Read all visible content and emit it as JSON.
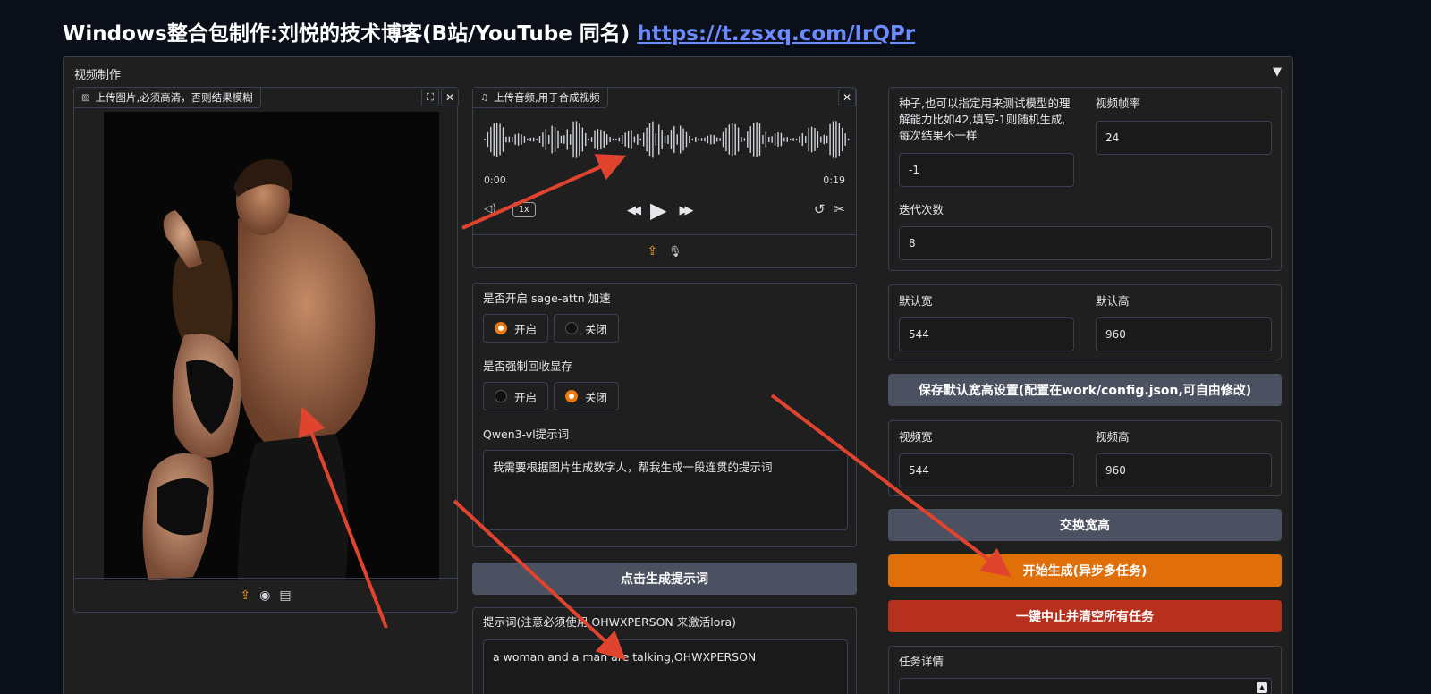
{
  "header": {
    "title": "Windows整合包制作:刘悦的技术博客(B站/YouTube 同名)",
    "link": "https://t.zsxq.com/IrQPr"
  },
  "accordion": {
    "label": "视频制作",
    "caret": "▼"
  },
  "image_input": {
    "label": "上传图片,必须高清，否则结果模糊",
    "fullscreen_icon": "⛶",
    "close_icon": "✕",
    "upload_icon": "⇪",
    "webcam_icon": "◉",
    "clipboard_icon": "▤"
  },
  "audio_input": {
    "label": "上传音频,用于合成视频",
    "current_time": "0:00",
    "duration": "0:19",
    "speed": "1x",
    "close_icon": "✕",
    "volume_icon": "◁)",
    "rewind_icon": "◀◀",
    "play_icon": "▶",
    "forward_icon": "▶▶",
    "undo_icon": "↺",
    "trim_icon": "✂",
    "upload_icon": "⇪",
    "mic_icon": "🎙"
  },
  "sage_attn": {
    "label": "是否开启 sage-attn 加速",
    "options": [
      "开启",
      "关闭"
    ],
    "selected": "开启"
  },
  "force_gc": {
    "label": "是否强制回收显存",
    "options": [
      "开启",
      "关闭"
    ],
    "selected": "关闭"
  },
  "qwen_prompt": {
    "label": "Qwen3-vl提示词",
    "value": "我需要根据图片生成数字人，帮我生成一段连贯的提示词"
  },
  "gen_prompt_button": "点击生成提示词",
  "prompt": {
    "label": "提示词(注意必须使用 OHWXPERSON 来激活lora)",
    "value": "a woman and a man are talking,OHWXPERSON"
  },
  "seed": {
    "label": "种子,也可以指定用来测试模型的理解能力比如42,填写-1则随机生成,每次结果不一样",
    "value": "-1"
  },
  "fps": {
    "label": "视频帧率",
    "value": "24"
  },
  "steps": {
    "label": "迭代次数",
    "value": "8"
  },
  "default_width": {
    "label": "默认宽",
    "value": "544"
  },
  "default_height": {
    "label": "默认高",
    "value": "960"
  },
  "save_default_button": "保存默认宽高设置(配置在work/config.json,可自由修改)",
  "video_width": {
    "label": "视频宽",
    "value": "544"
  },
  "video_height": {
    "label": "视频高",
    "value": "960"
  },
  "swap_button": "交换宽高",
  "start_button": "开始生成(异步多任务)",
  "stop_button": "一键中止并清空所有任务",
  "task_details": {
    "label": "任务详情"
  },
  "colors": {
    "accent_orange": "#e06f0a",
    "danger_red": "#b7301e",
    "annotation_arrow": "#e0432e"
  }
}
